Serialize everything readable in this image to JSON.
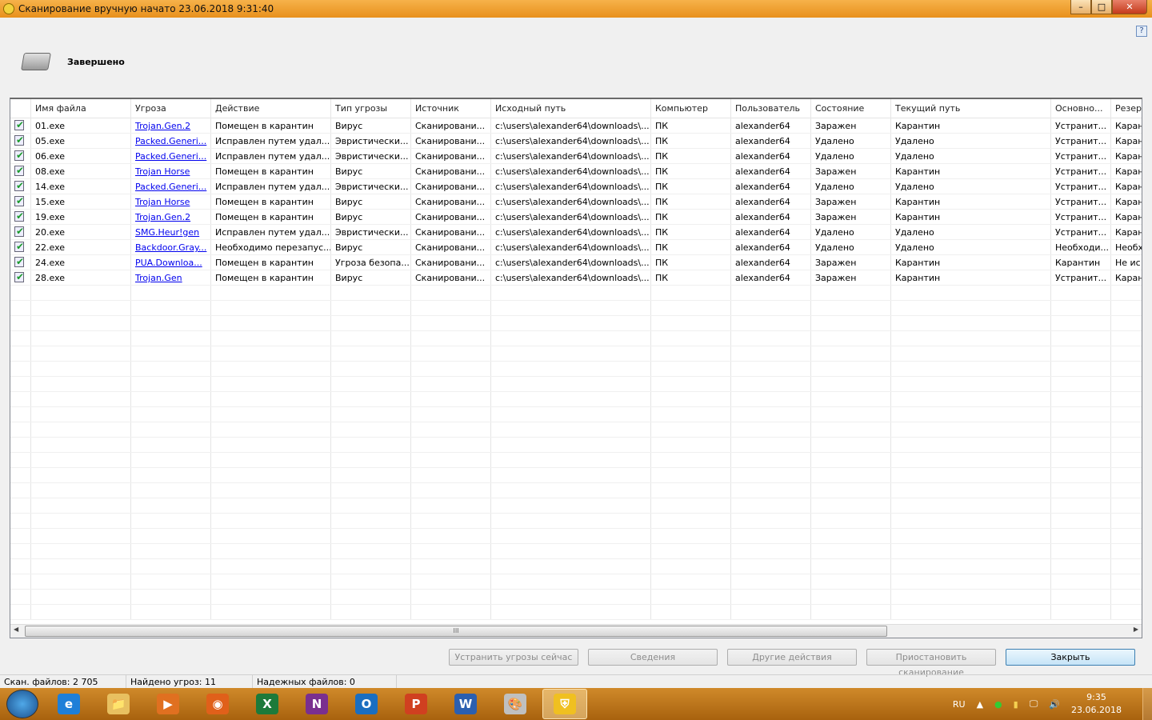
{
  "window": {
    "title": "Сканирование вручную начато 23.06.2018 9:31:40",
    "help": "?"
  },
  "status": "Завершено",
  "columns": [
    "",
    "Имя файла",
    "Угроза",
    "Действие",
    "Тип угрозы",
    "Источник",
    "Исходный путь",
    "Компьютер",
    "Пользователь",
    "Состояние",
    "Текущий путь",
    "Основно...",
    "Резер"
  ],
  "rows": [
    [
      "01.exe",
      "Trojan.Gen.2",
      "Помещен в карантин",
      "Вирус",
      "Сканировани...",
      "c:\\users\\alexander64\\downloads\\...",
      "ПК",
      "alexander64",
      "Заражен",
      "Карантин",
      "Устранит...",
      "Каран"
    ],
    [
      "05.exe",
      "Packed.Generi...",
      "Исправлен путем удал...",
      "Эвристически...",
      "Сканировани...",
      "c:\\users\\alexander64\\downloads\\...",
      "ПК",
      "alexander64",
      "Удалено",
      "Удалено",
      "Устранит...",
      "Каран"
    ],
    [
      "06.exe",
      "Packed.Generi...",
      "Исправлен путем удал...",
      "Эвристически...",
      "Сканировани...",
      "c:\\users\\alexander64\\downloads\\...",
      "ПК",
      "alexander64",
      "Удалено",
      "Удалено",
      "Устранит...",
      "Каран"
    ],
    [
      "08.exe",
      "Trojan Horse",
      "Помещен в карантин",
      "Вирус",
      "Сканировани...",
      "c:\\users\\alexander64\\downloads\\...",
      "ПК",
      "alexander64",
      "Заражен",
      "Карантин",
      "Устранит...",
      "Каран"
    ],
    [
      "14.exe",
      "Packed.Generi...",
      "Исправлен путем удал...",
      "Эвристически...",
      "Сканировани...",
      "c:\\users\\alexander64\\downloads\\...",
      "ПК",
      "alexander64",
      "Удалено",
      "Удалено",
      "Устранит...",
      "Каран"
    ],
    [
      "15.exe",
      "Trojan Horse",
      "Помещен в карантин",
      "Вирус",
      "Сканировани...",
      "c:\\users\\alexander64\\downloads\\...",
      "ПК",
      "alexander64",
      "Заражен",
      "Карантин",
      "Устранит...",
      "Каран"
    ],
    [
      "19.exe",
      "Trojan.Gen.2",
      "Помещен в карантин",
      "Вирус",
      "Сканировани...",
      "c:\\users\\alexander64\\downloads\\...",
      "ПК",
      "alexander64",
      "Заражен",
      "Карантин",
      "Устранит...",
      "Каран"
    ],
    [
      "20.exe",
      "SMG.Heur!gen",
      "Исправлен путем удал...",
      "Эвристически...",
      "Сканировани...",
      "c:\\users\\alexander64\\downloads\\...",
      "ПК",
      "alexander64",
      "Удалено",
      "Удалено",
      "Устранит...",
      "Каран"
    ],
    [
      "22.exe",
      "Backdoor.Gray...",
      "Необходимо перезапус...",
      "Вирус",
      "Сканировани...",
      "c:\\users\\alexander64\\downloads\\...",
      "ПК",
      "alexander64",
      "Удалено",
      "Удалено",
      "Необходи...",
      "Необх"
    ],
    [
      "24.exe",
      "PUA.Downloa...",
      "Помещен в карантин",
      "Угроза безопа...",
      "Сканировани...",
      "c:\\users\\alexander64\\downloads\\...",
      "ПК",
      "alexander64",
      "Заражен",
      "Карантин",
      "Карантин",
      "Не ис"
    ],
    [
      "28.exe",
      "Trojan.Gen",
      "Помещен в карантин",
      "Вирус",
      "Сканировани...",
      "c:\\users\\alexander64\\downloads\\...",
      "ПК",
      "alexander64",
      "Заражен",
      "Карантин",
      "Устранит...",
      "Каран"
    ]
  ],
  "scroll_grip": "III",
  "buttons": {
    "fix": "Устранить угрозы сейчас",
    "details": "Сведения",
    "other": "Другие действия",
    "pause": "Приостановить сканирование",
    "close": "Закрыть"
  },
  "statusbar": {
    "scanned": "Скан. файлов: 2 705",
    "threats": "Найдено угроз: 11",
    "trusted": "Надежных файлов: 0"
  },
  "taskbar": {
    "apps": [
      "Internet Explorer",
      "Explorer",
      "Media Player",
      "Firefox",
      "Excel",
      "OneNote",
      "Outlook",
      "PowerPoint",
      "Word",
      "Paint",
      "Norton"
    ],
    "lang": "RU",
    "time": "9:35",
    "date": "23.06.2018"
  }
}
